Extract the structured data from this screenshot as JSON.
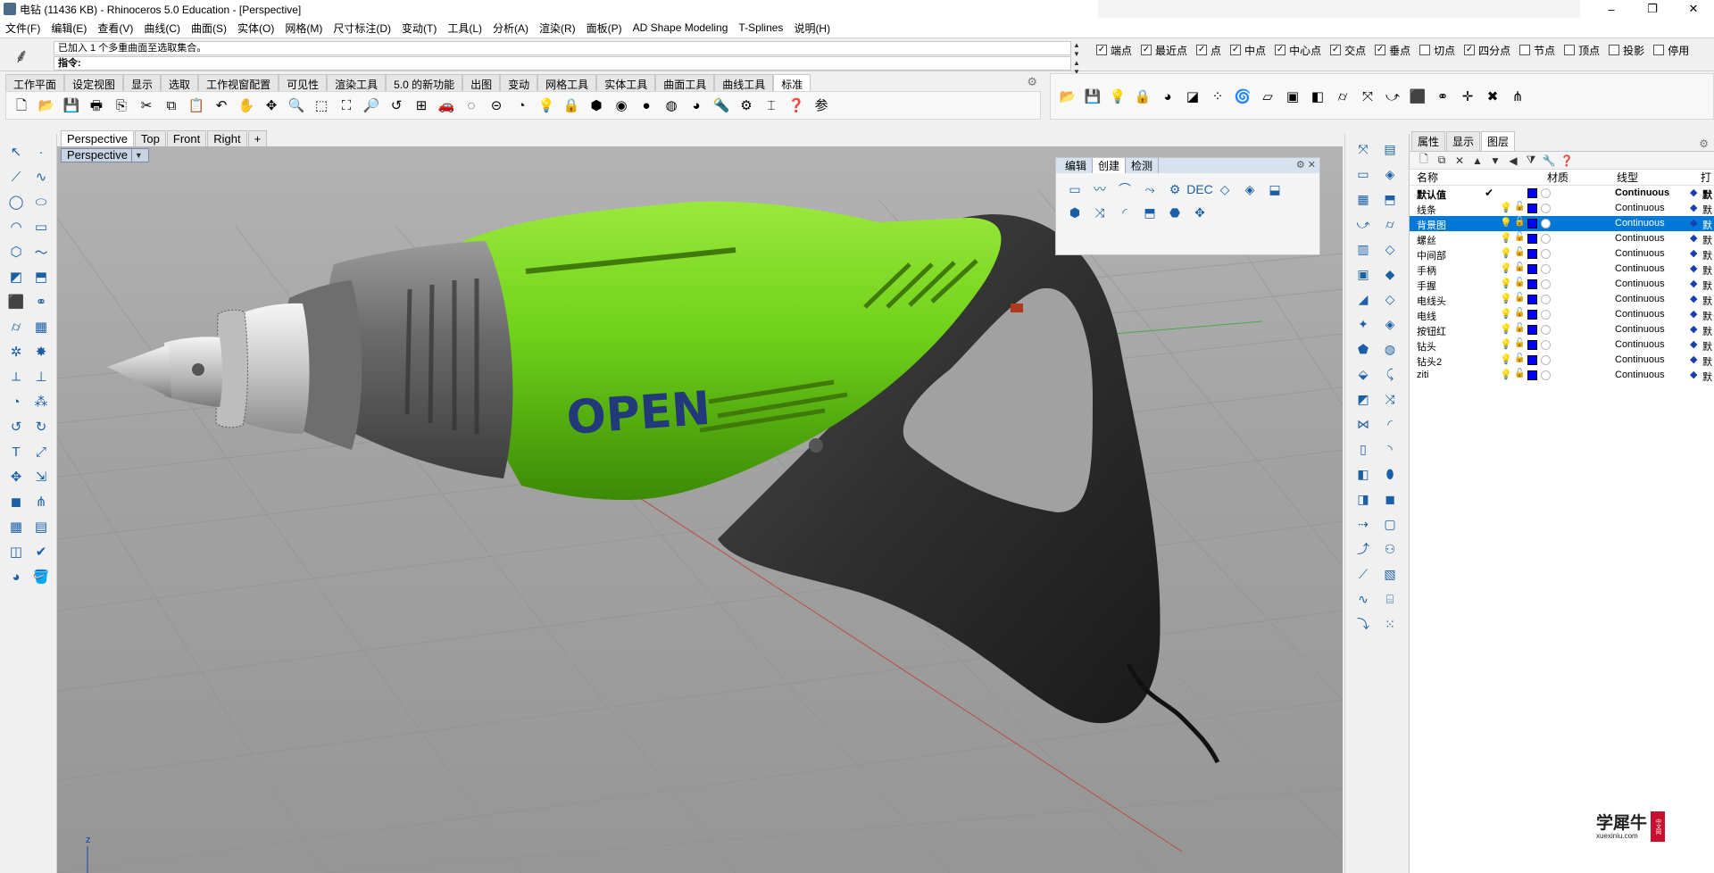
{
  "window": {
    "title": "电钻 (11436 KB) - Rhinoceros 5.0 Education - [Perspective]",
    "controls": [
      "–",
      "❐",
      "✕"
    ]
  },
  "menu": [
    "文件(F)",
    "编辑(E)",
    "查看(V)",
    "曲线(C)",
    "曲面(S)",
    "实体(O)",
    "网格(M)",
    "尺寸标注(D)",
    "变动(T)",
    "工具(L)",
    "分析(A)",
    "渲染(R)",
    "面板(P)",
    "AD Shape Modeling",
    "T-Splines",
    "说明(H)"
  ],
  "command": {
    "history": "已加入 1 个多重曲面至选取集合。",
    "prompt": "指令:"
  },
  "osnaps": [
    {
      "label": "端点",
      "checked": true
    },
    {
      "label": "最近点",
      "checked": true
    },
    {
      "label": "点",
      "checked": true
    },
    {
      "label": "中点",
      "checked": true
    },
    {
      "label": "中心点",
      "checked": true
    },
    {
      "label": "交点",
      "checked": true
    },
    {
      "label": "垂点",
      "checked": true
    },
    {
      "label": "切点",
      "checked": false
    },
    {
      "label": "四分点",
      "checked": true
    },
    {
      "label": "节点",
      "checked": false
    },
    {
      "label": "顶点",
      "checked": false
    },
    {
      "label": "投影",
      "checked": false
    },
    {
      "label": "停用",
      "checked": false
    }
  ],
  "toolbar_tabs": [
    "工作平面",
    "设定视图",
    "显示",
    "选取",
    "工作视窗配置",
    "可见性",
    "渲染工具",
    "5.0 的新功能",
    "出图",
    "变动",
    "网格工具",
    "实体工具",
    "曲面工具",
    "曲线工具",
    "标准"
  ],
  "active_toolbar_tab": "标准",
  "viewport_tabs": [
    "Perspective",
    "Top",
    "Front",
    "Right",
    "+"
  ],
  "active_viewport": "Perspective",
  "viewport_label": "Perspective",
  "model_text": "OPEN",
  "axis_label": "z",
  "float_panel": {
    "tabs": [
      "编辑",
      "创建",
      "检测"
    ],
    "active": "创建",
    "icons": [
      "▭",
      "〰",
      "⌒",
      "⤳",
      "⚙",
      "DEC",
      "◇",
      "◈",
      "⬓",
      "⬢",
      "⤨",
      "◜",
      "⬒",
      "⬣",
      "✥"
    ]
  },
  "layer_panel": {
    "tabs": [
      "属性",
      "显示",
      "图层"
    ],
    "active_tab": "图层",
    "columns": {
      "name": "名称",
      "material": "材质",
      "linetype": "线型",
      "print": "打"
    },
    "layers": [
      {
        "name": "默认值",
        "current": true,
        "linetype": "Continuous",
        "print": "默",
        "selected": false
      },
      {
        "name": "线条",
        "current": false,
        "linetype": "Continuous",
        "print": "默",
        "selected": false
      },
      {
        "name": "背景图",
        "current": false,
        "linetype": "Continuous",
        "print": "默",
        "selected": true
      },
      {
        "name": "螺丝",
        "current": false,
        "linetype": "Continuous",
        "print": "默",
        "selected": false
      },
      {
        "name": "中间部",
        "current": false,
        "linetype": "Continuous",
        "print": "默",
        "selected": false
      },
      {
        "name": "手柄",
        "current": false,
        "linetype": "Continuous",
        "print": "默",
        "selected": false
      },
      {
        "name": "手握",
        "current": false,
        "linetype": "Continuous",
        "print": "默",
        "selected": false
      },
      {
        "name": "电线头",
        "current": false,
        "linetype": "Continuous",
        "print": "默",
        "selected": false
      },
      {
        "name": "电线",
        "current": false,
        "linetype": "Continuous",
        "print": "默",
        "selected": false
      },
      {
        "name": "按钮红",
        "current": false,
        "linetype": "Continuous",
        "print": "默",
        "selected": false
      },
      {
        "name": "钻头",
        "current": false,
        "linetype": "Continuous",
        "print": "默",
        "selected": false
      },
      {
        "name": "钻头2",
        "current": false,
        "linetype": "Continuous",
        "print": "默",
        "selected": false
      },
      {
        "name": "ziti",
        "current": false,
        "linetype": "Continuous",
        "print": "默",
        "selected": false
      }
    ]
  },
  "watermark": {
    "text": "学犀牛",
    "sub": "xuexiniu.com",
    "badge": "中文网"
  },
  "colors": {
    "body_green": "#6fd11a",
    "handle_dark": "#2e2e2e",
    "layer_color": "#0000ff",
    "selection": "#0078d7"
  }
}
